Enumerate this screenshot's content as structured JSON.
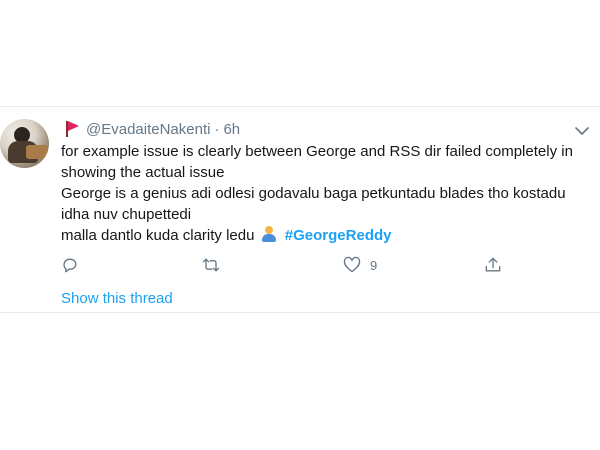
{
  "tweet": {
    "handle": "@EvadaiteNakenti",
    "separator": "·",
    "time": "6h",
    "lines": [
      "for example issue is clearly between George and RSS dir failed completely in",
      "showing the actual issue",
      "George is a genius adi odlesi godavalu baga petkuntadu blades tho kostadu",
      "idha nuv chupettedi"
    ],
    "last_line_text": "malla dantlo kuda clarity ledu",
    "hashtag": "#GeorgeReddy",
    "like_count": "9",
    "show_thread": "Show this thread",
    "accent_color": "#1da1f2",
    "icons": [
      "flag-icon",
      "chevron-down-icon",
      "reply-icon",
      "retweet-icon",
      "like-icon",
      "share-icon"
    ]
  }
}
